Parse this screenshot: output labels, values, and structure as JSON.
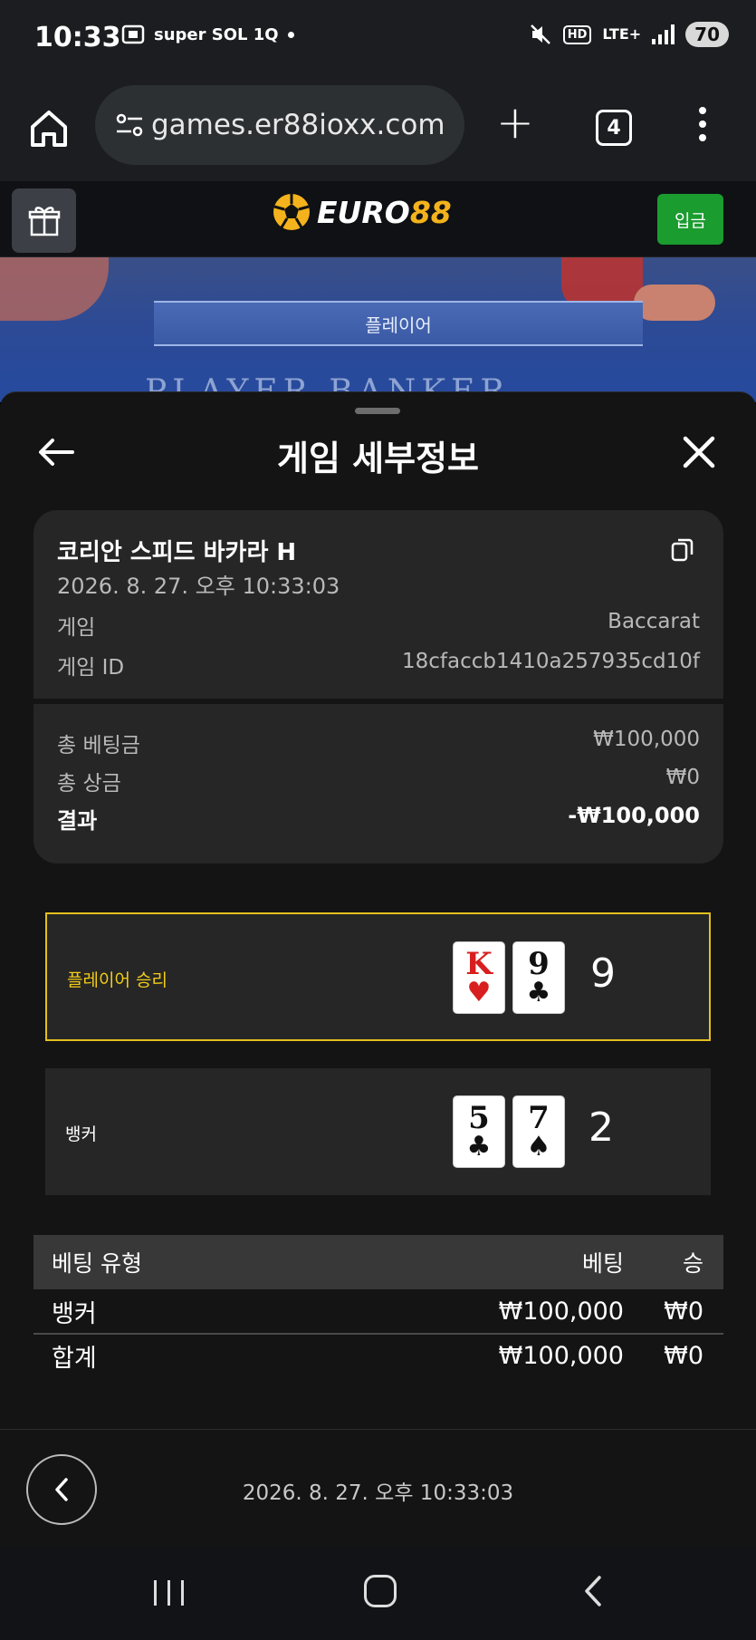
{
  "status_bar": {
    "time": "10:33",
    "left_icons_text": "super SOL 1Q",
    "hd": "HD",
    "network": "LTE+",
    "battery": "70"
  },
  "browser": {
    "url": "games.er88ioxx.com",
    "tab_count": "4"
  },
  "site_header": {
    "logo_part1": "EURO",
    "logo_part2": "88",
    "deposit_label": "입금"
  },
  "background": {
    "band_label": "플레이어",
    "table_words": "PLAYER    BANKER"
  },
  "sheet": {
    "title": "게임 세부정보",
    "game_name": "코리안 스피드 바카라 H",
    "game_datetime": "2026. 8. 27. 오후 10:33:03",
    "game_label": "게임",
    "game_value": "Baccarat",
    "game_id_label": "게임 ID",
    "game_id_value": "18cfaccb1410a257935cd10f",
    "total_bet_label": "총 베팅금",
    "total_bet_value": "₩100,000",
    "total_prize_label": "총 상금",
    "total_prize_value": "₩0",
    "result_label": "결과",
    "result_value": "-₩100,000"
  },
  "results": {
    "player": {
      "label": "플레이어 승리",
      "cards": [
        {
          "rank": "K",
          "suit": "♥"
        },
        {
          "rank": "9",
          "suit": "♣"
        }
      ],
      "score": "9"
    },
    "banker": {
      "label": "뱅커",
      "cards": [
        {
          "rank": "5",
          "suit": "♣"
        },
        {
          "rank": "7",
          "suit": "♠"
        }
      ],
      "score": "2"
    }
  },
  "bet_table": {
    "headers": {
      "type": "베팅 유형",
      "bet": "베팅",
      "win": "승"
    },
    "rows": [
      {
        "type": "뱅커",
        "bet": "₩100,000",
        "win": "₩0"
      }
    ],
    "total": {
      "type": "합계",
      "bet": "₩100,000",
      "win": "₩0"
    }
  },
  "footer": {
    "date": "2026. 8. 27. 오후 10:33:03"
  },
  "colors": {
    "win_highlight": "#e3c01c",
    "deposit_green": "#1a9c2f",
    "logo_yellow": "#f4b31c"
  }
}
